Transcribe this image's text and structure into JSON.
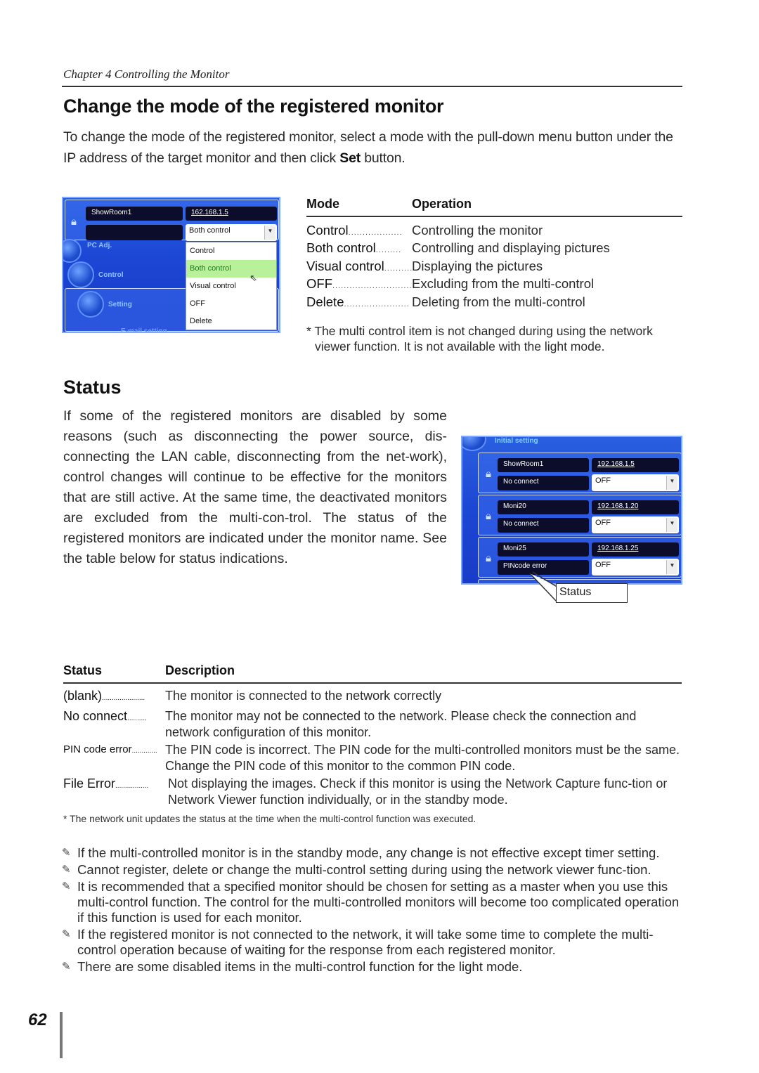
{
  "header": {
    "chapter": "Chapter 4 Controlling the Monitor"
  },
  "section1": {
    "title": "Change the mode of the registered monitor",
    "intro_before": "To change the mode of the registered monitor, select a mode with the pull-down menu button under the IP address of the target monitor and then click ",
    "intro_bold": "Set",
    "intro_after": " button."
  },
  "screenshot1": {
    "monitor_name": "ShowRoom1",
    "ip": "162.168.1.5",
    "status": "",
    "selected_mode": "Both control",
    "dropdown_options": [
      "Control",
      "Both control",
      "Visual control",
      "OFF",
      "Delete"
    ],
    "highlighted_option": "Both control",
    "nav": [
      "PC Adj.",
      "Control",
      "Setting",
      "E-mail setting"
    ]
  },
  "mode_table": {
    "headers": [
      "Mode",
      "Operation"
    ],
    "rows": [
      {
        "mode": "Control",
        "operation": "Controlling the monitor"
      },
      {
        "mode": "Both control",
        "operation": "Controlling and displaying pictures"
      },
      {
        "mode": "Visual control",
        "operation": "Displaying the pictures"
      },
      {
        "mode": "OFF",
        "operation": "Excluding from the multi-control"
      },
      {
        "mode": "Delete",
        "operation": "Deleting from the multi-control"
      }
    ],
    "note": "* The multi control item is not changed during using the network viewer function. It is not available with the light mode."
  },
  "section2": {
    "title": "Status",
    "paragraph": "If some of the registered monitors are disabled by some reasons (such as disconnecting the power source, dis-connecting the LAN cable, disconnecting from the net-work), control changes will continue to be effective for the monitors that are still active. At the same time, the deactivated monitors are excluded from the multi-con-trol. The status of the registered monitors are indicated under the monitor name. See the table below for status indications."
  },
  "screenshot2": {
    "header_label": "Initial setting",
    "monitors": [
      {
        "name": "ShowRoom1",
        "ip": "192.168.1.5",
        "status": "No connect",
        "mode": "OFF"
      },
      {
        "name": "Moni20",
        "ip": "192.168.1.20",
        "status": "No connect",
        "mode": "OFF"
      },
      {
        "name": "Moni25",
        "ip": "192.168.1.25",
        "status": "PINcode error",
        "mode": "OFF"
      }
    ],
    "callout": "Status"
  },
  "status_table": {
    "headers": [
      "Status",
      "Description"
    ],
    "rows": [
      {
        "status": "(blank)",
        "description": "The monitor is connected to the network correctly"
      },
      {
        "status": "No connect",
        "description": "The monitor may not be connected to the network. Please check the connection and network configuration of this monitor."
      },
      {
        "status": "PIN code error",
        "description": "The PIN code is incorrect. The PIN code for the multi-controlled monitors must be the same. Change the PIN code of this monitor to the common PIN code."
      },
      {
        "status": "File Error",
        "description": "Not displaying the images. Check if this monitor is using the Network Capture func-tion or Network Viewer function individually, or  in the standby mode."
      }
    ],
    "note": "* The network unit updates the status at the time when the multi-control function was executed."
  },
  "notes": [
    "If the multi-controlled monitor is in the standby mode, any change is not effective except timer setting.",
    "Cannot register, delete or change the multi-control setting during using the network viewer func-tion.",
    "It is recommended that a specified monitor should be chosen for setting as a master when you use this multi-control function. The control for the multi-controlled monitors will become too complicated operation if this function is used for each monitor.",
    "If the registered monitor is not connected to the network, it will take some time to complete the multi-control operation because of waiting for the response from each registered monitor.",
    "There are some disabled items in the multi-control function for the light mode."
  ],
  "footer": {
    "page_number": "62"
  }
}
